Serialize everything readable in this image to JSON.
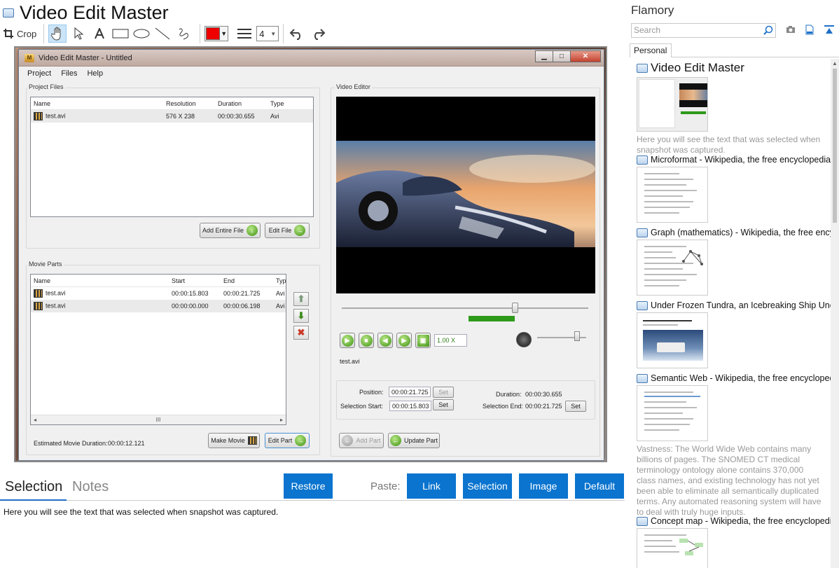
{
  "app": {
    "title": "Video Edit Master",
    "toolbar": {
      "crop_label": "Crop",
      "line_width": "4",
      "color": "#ee0000"
    }
  },
  "inner_app": {
    "window_title": "Video Edit Master - Untitled",
    "menu": [
      "Project",
      "Files",
      "Help"
    ],
    "project_files": {
      "label": "Project Files",
      "headers": [
        "Name",
        "Resolution",
        "Duration",
        "Type"
      ],
      "rows": [
        {
          "name": "test.avi",
          "resolution": "576 X 238",
          "duration": "00:00:30.655",
          "type": "Avi"
        }
      ],
      "add_entire_file": "Add Entire File",
      "edit_file": "Edit File"
    },
    "movie_parts": {
      "label": "Movie Parts",
      "headers": [
        "Name",
        "Start",
        "End",
        "Typ"
      ],
      "rows": [
        {
          "name": "test.avi",
          "start": "00:00:15.803",
          "end": "00:00:21.725",
          "type": "Avi"
        },
        {
          "name": "test.avi",
          "start": "00:00:00.000",
          "end": "00:00:06.198",
          "type": "Avi"
        }
      ],
      "estimated_label": "Estimated Movie Duration:",
      "estimated_value": "00:00:12.121",
      "make_movie": "Make Movie",
      "edit_part": "Edit Part",
      "scroll_glyph": "III"
    },
    "video_editor": {
      "label": "Video Editor",
      "speed": "1.00 X",
      "filename": "test.avi",
      "position_label": "Position:",
      "position_value": "00:00:21.725",
      "duration_label": "Duration:",
      "duration_value": "00:00:30.655",
      "sel_start_label": "Selection Start:",
      "sel_start_value": "00:00:15.803",
      "sel_end_label": "Selection End:",
      "sel_end_value": "00:00:21.725",
      "set": "Set",
      "add_part": "Add Part",
      "update_part": "Update Part"
    }
  },
  "tabs": {
    "selection": "Selection",
    "notes": "Notes"
  },
  "paste_bar": {
    "restore": "Restore",
    "paste_label": "Paste:",
    "link": "Link",
    "selection": "Selection",
    "image": "Image",
    "default": "Default"
  },
  "selection_text": "Here you will see the text that was selected when snapshot was captured.",
  "sidebar": {
    "title": "Flamory",
    "search_placeholder": "Search",
    "tab": "Personal",
    "entries": [
      {
        "title": "Video Edit Master",
        "note": "Here you will see the text that was selected when snapshot was captured."
      },
      {
        "title": "Microformat - Wikipedia, the free encyclopedia"
      },
      {
        "title": "Graph (mathematics) - Wikipedia, the free ency"
      },
      {
        "title": "Under Frozen Tundra, an Icebreaking Ship Unco"
      },
      {
        "title": "Semantic Web - Wikipedia, the free encycloped",
        "note": "Vastness: The World Wide Web contains many billions of pages. The SNOMED CT medical terminology ontology alone contains 370,000 class names, and existing technology has not yet been able to eliminate all semantically duplicated terms. Any automated reasoning system will have to deal with truly huge inputs."
      },
      {
        "title": "Concept map - Wikipedia, the free encyclopedi"
      }
    ]
  }
}
